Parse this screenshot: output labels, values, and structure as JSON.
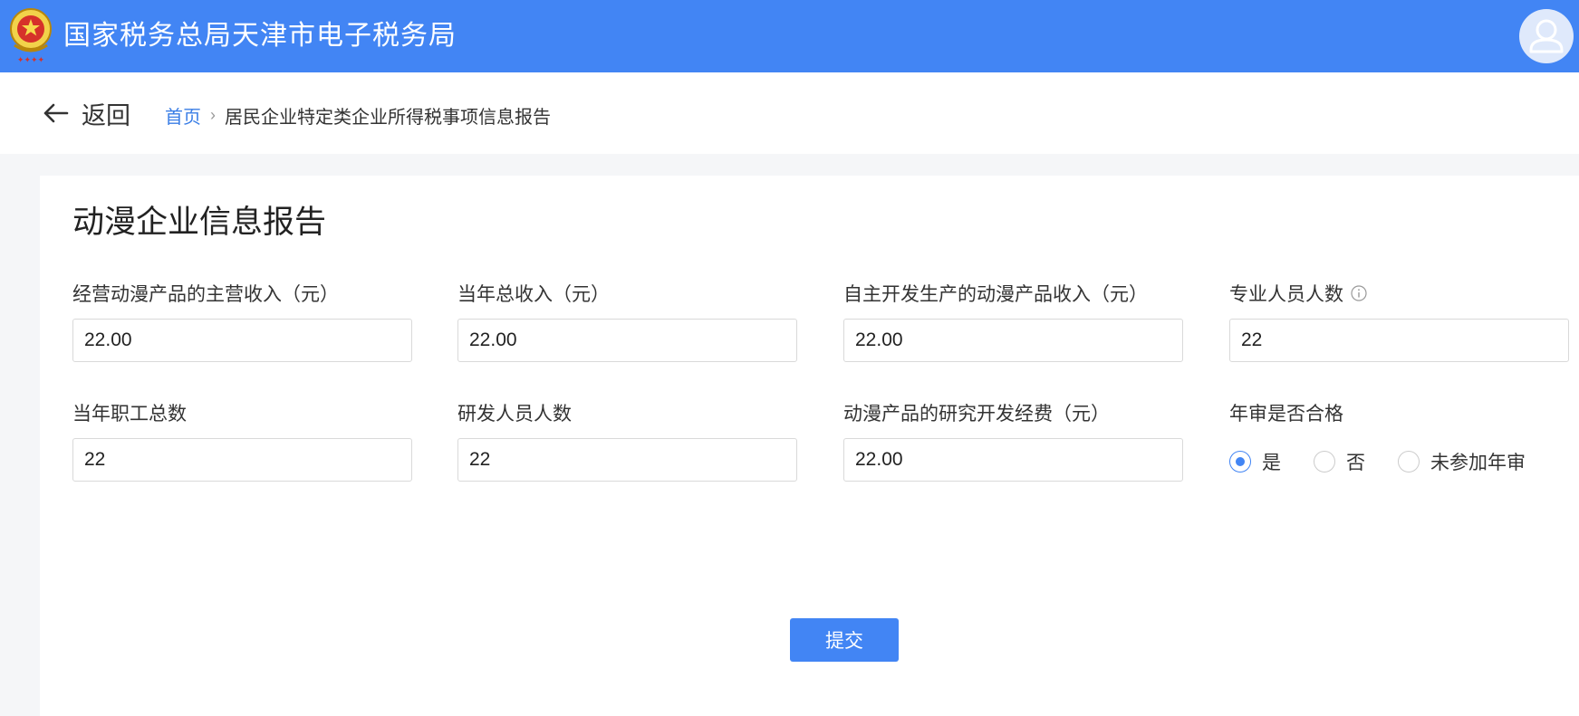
{
  "header": {
    "title": "国家税务总局天津市电子税务局",
    "emblem_icon": "tax-emblem-icon",
    "avatar_icon": "user-avatar-icon"
  },
  "nav": {
    "back_label": "返回",
    "breadcrumb": {
      "home": "首页",
      "separator": "›",
      "current": "居民企业特定类企业所得税事项信息报告"
    }
  },
  "form": {
    "title": "动漫企业信息报告",
    "fields": [
      {
        "label": "经营动漫产品的主营收入（元）",
        "value": "22.00"
      },
      {
        "label": "当年总收入（元）",
        "value": "22.00"
      },
      {
        "label": "自主开发生产的动漫产品收入（元）",
        "value": "22.00"
      },
      {
        "label": "专业人员人数",
        "value": "22",
        "info_icon": "info-icon"
      },
      {
        "label": "当年职工总数",
        "value": "22"
      },
      {
        "label": "研发人员人数",
        "value": "22"
      },
      {
        "label": "动漫产品的研究开发经费（元）",
        "value": "22.00"
      }
    ],
    "annual_review": {
      "label": "年审是否合格",
      "options": [
        "是",
        "否",
        "未参加年审"
      ],
      "selected": "是"
    },
    "submit_label": "提交"
  },
  "colors": {
    "brand": "#4285f4",
    "link": "#3a7ee6",
    "background": "#f5f6f8"
  }
}
